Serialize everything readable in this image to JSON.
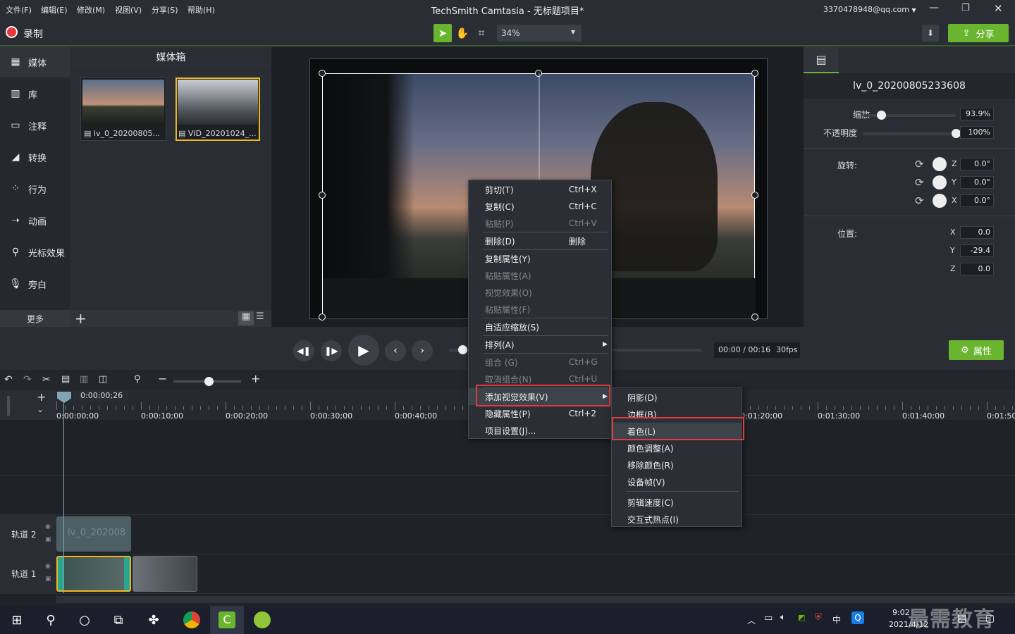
{
  "window": {
    "title": "TechSmith Camtasia - 无标题项目*",
    "account": "3370478948@qq.com"
  },
  "menu": [
    "文件(F)",
    "编辑(E)",
    "修改(M)",
    "视图(V)",
    "分享(S)",
    "帮助(H)"
  ],
  "toolbar": {
    "record_label": "录制",
    "zoom_value": "34%",
    "share_label": "分享"
  },
  "nav": {
    "items": [
      {
        "label": "媒体",
        "icon": "media-icon"
      },
      {
        "label": "库",
        "icon": "library-icon"
      },
      {
        "label": "注释",
        "icon": "annotation-icon"
      },
      {
        "label": "转换",
        "icon": "transition-icon"
      },
      {
        "label": "行为",
        "icon": "behavior-icon"
      },
      {
        "label": "动画",
        "icon": "animation-icon"
      },
      {
        "label": "光标效果",
        "icon": "cursor-icon"
      },
      {
        "label": "旁白",
        "icon": "mic-icon"
      }
    ],
    "more_label": "更多"
  },
  "mediabin": {
    "title": "媒体箱",
    "clips": [
      {
        "name": "lv_0_20200805..."
      },
      {
        "name": "VID_20201024_..."
      }
    ]
  },
  "properties": {
    "clip_name": "lv_0_20200805233608",
    "scale_label": "缩放",
    "scale_value": "93.9%",
    "scale_fraction": 0.2,
    "opacity_label": "不透明度",
    "opacity_value": "100%",
    "opacity_fraction": 1.0,
    "rotation_label": "旋转:",
    "rotation": [
      {
        "axis": "Z",
        "value": "0.0°"
      },
      {
        "axis": "Y",
        "value": "0.0°"
      },
      {
        "axis": "X",
        "value": "0.0°"
      }
    ],
    "position_label": "位置:",
    "position": [
      {
        "axis": "X",
        "value": "0.0"
      },
      {
        "axis": "Y",
        "value": "-29.4"
      },
      {
        "axis": "Z",
        "value": "0.0"
      }
    ],
    "button_label": "属性"
  },
  "playback": {
    "time": "00:00 / 00:16",
    "fps": "30fps"
  },
  "timeline": {
    "playhead_time": "0:00:00;26",
    "ticks": [
      "0:00:00;00",
      "0:00:10;00",
      "0:00:20;00",
      "0:00:30;00",
      "0:00:40;00",
      "0:01:20;00",
      "0:01:30;00",
      "0:01:40;00",
      "0:01:50;"
    ],
    "tracks": [
      {
        "label": "轨道 2"
      },
      {
        "label": "轨道 1"
      }
    ],
    "track2_clip": "lv_0_202008"
  },
  "context_menu": {
    "items": [
      {
        "label": "剪切(T)",
        "shortcut": "Ctrl+X",
        "disabled": false
      },
      {
        "label": "复制(C)",
        "shortcut": "Ctrl+C",
        "disabled": false
      },
      {
        "label": "粘贴(P)",
        "shortcut": "Ctrl+V",
        "disabled": true
      },
      {
        "label": "删除(D)",
        "shortcut": "删除",
        "disabled": false
      },
      {
        "label": "复制属性(Y)",
        "shortcut": "",
        "disabled": false
      },
      {
        "label": "粘贴属性(A)",
        "shortcut": "",
        "disabled": true
      },
      {
        "label": "视觉效果(O)",
        "shortcut": "",
        "disabled": true
      },
      {
        "label": "粘贴属性(F)",
        "shortcut": "",
        "disabled": true
      },
      {
        "label": "自适应缩放(S)",
        "shortcut": "",
        "disabled": false
      },
      {
        "label": "排列(A)",
        "shortcut": "",
        "disabled": false
      },
      {
        "label": "组合 (G)",
        "shortcut": "Ctrl+G",
        "disabled": true
      },
      {
        "label": "取消组合(N)",
        "shortcut": "Ctrl+U",
        "disabled": true
      },
      {
        "label": "添加视觉效果(V)",
        "shortcut": "",
        "disabled": false
      },
      {
        "label": "隐藏属性(P)",
        "shortcut": "Ctrl+2",
        "disabled": false
      },
      {
        "label": "项目设置(J)...",
        "shortcut": "",
        "disabled": false
      }
    ]
  },
  "submenu": {
    "items": [
      {
        "label": "阴影(D)"
      },
      {
        "label": "边框(B)"
      },
      {
        "label": "着色(L)"
      },
      {
        "label": "颜色调整(A)"
      },
      {
        "label": "移除颜色(R)"
      },
      {
        "label": "设备帧(V)"
      },
      {
        "label": "剪辑速度(C)"
      },
      {
        "label": "交互式热点(I)"
      }
    ]
  },
  "taskbar": {
    "time": "9:02",
    "date": "2021/4/12",
    "ime": "中",
    "watermark": "最需教育"
  },
  "colors": {
    "accent_green": "#6ab52f",
    "highlight_red": "#e13b3b",
    "record_red": "#e8383a"
  }
}
